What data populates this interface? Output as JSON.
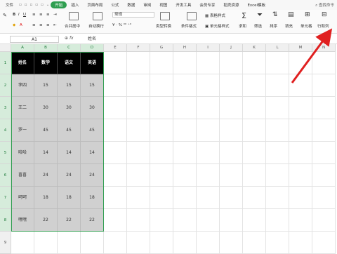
{
  "menu": {
    "items": [
      "文件",
      "开始",
      "插入",
      "页面布局",
      "公式",
      "数据",
      "审阅",
      "视图",
      "开发工具",
      "会员专享",
      "稻壳资源",
      "Excel模板"
    ],
    "active_index": 1,
    "search": "查找命令"
  },
  "ribbon": {
    "merge_center": "合并居中",
    "auto_wrap": "自动换行",
    "format_box": "常规",
    "type_convert": "类型转换",
    "cond_format": "条件格式",
    "table_style": "表格样式",
    "cell_style": "单元格样式",
    "sum": "求和",
    "filter": "筛选",
    "sort": "排序",
    "fill": "填充",
    "cell": "单元格",
    "row_col": "行和列"
  },
  "formula_bar": {
    "name_box": "A1",
    "fx": "fx",
    "content": "姓名"
  },
  "columns": [
    "A",
    "B",
    "C",
    "D",
    "E",
    "F",
    "G",
    "H",
    "I",
    "J",
    "K",
    "L",
    "M",
    "N"
  ],
  "rows": [
    "1",
    "2",
    "3",
    "4",
    "5",
    "6",
    "7",
    "8",
    "9"
  ],
  "table": {
    "headers": [
      "姓名",
      "数学",
      "语文",
      "英语"
    ],
    "rows": [
      [
        "李四",
        "15",
        "15",
        "15"
      ],
      [
        "王二",
        "30",
        "30",
        "30"
      ],
      [
        "罗一",
        "45",
        "45",
        "45"
      ],
      [
        "哈哈",
        "14",
        "14",
        "14"
      ],
      [
        "喜喜",
        "24",
        "24",
        "24"
      ],
      [
        "呵呵",
        "18",
        "18",
        "18"
      ],
      [
        "嘿嘿",
        "22",
        "22",
        "22"
      ]
    ]
  },
  "colors": {
    "accent": "#2e9e4f",
    "header_bg": "#000000",
    "data_bg": "#d0d0d0",
    "arrow": "#e02020"
  }
}
